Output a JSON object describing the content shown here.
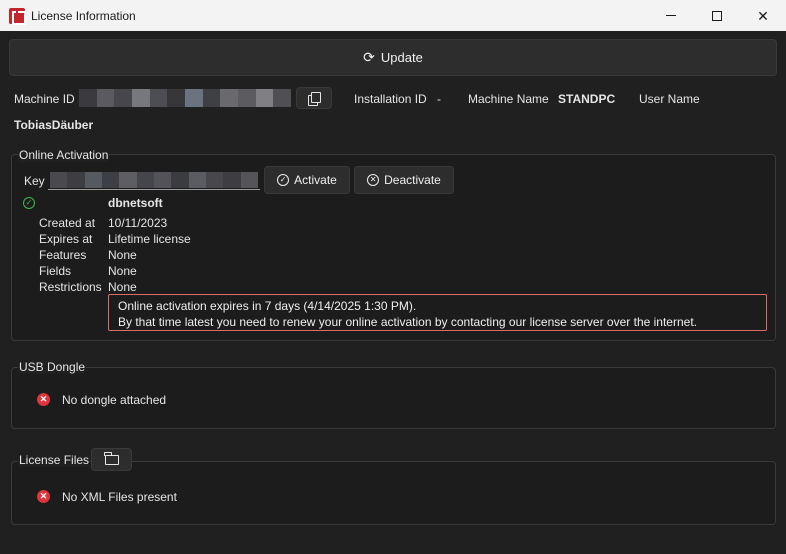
{
  "window": {
    "title": "License Information"
  },
  "toolbar": {
    "update_label": "Update"
  },
  "machine": {
    "machine_id_label": "Machine ID",
    "installation_id_label": "Installation ID",
    "installation_id_value": "-",
    "machine_name_label": "Machine Name",
    "machine_name_value": "STANDPC",
    "user_name_label": "User Name",
    "user_name_value": "TobiasDäuber"
  },
  "online_activation": {
    "title": "Online Activation",
    "key_label": "Key",
    "activate_label": "Activate",
    "deactivate_label": "Deactivate",
    "licensee": "dbnetsoft",
    "created_label": "Created at",
    "created_value": "10/11/2023",
    "expires_label": "Expires at",
    "expires_value": "Lifetime license",
    "features_label": "Features",
    "features_value": "None",
    "fields_label": "Fields",
    "fields_value": "None",
    "restrictions_label": "Restrictions",
    "restrictions_value": "None",
    "warning_line1": "Online activation expires in 7 days (4/14/2025 1:30 PM).",
    "warning_line2": "By that time latest you need to renew your online activation by contacting our license server over the internet."
  },
  "usb_dongle": {
    "title": "USB Dongle",
    "status": "No dongle attached"
  },
  "license_files": {
    "title": "License Files",
    "status": "No XML Files present"
  },
  "colors": {
    "background": "#202020",
    "titlebar": "#f3f3f3",
    "warning_border": "#e06b66",
    "error": "#e0343c",
    "success": "#3fb950"
  },
  "redaction_tiles": {
    "machine_id": [
      "#3b3b3f",
      "#5a5a60",
      "#46464c",
      "#76787e",
      "#4c4e54",
      "#37373a",
      "#6b7280",
      "#3f4044",
      "#6a6a6e",
      "#5c5c60",
      "#808084",
      "#505054"
    ],
    "key": [
      "#4a4a4e",
      "#3e3e42",
      "#565a60",
      "#3d3f44",
      "#5e5e62",
      "#44464c",
      "#525258",
      "#3a3c40",
      "#5a5c62",
      "#48484c",
      "#3e3e42",
      "#555559"
    ]
  }
}
